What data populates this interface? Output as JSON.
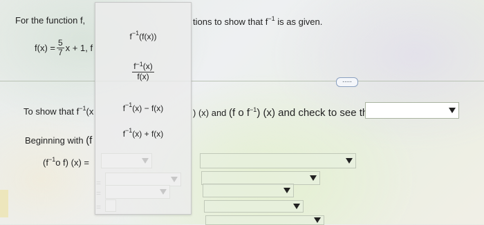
{
  "problem": {
    "intro": "For the function f,",
    "intro_right": "tions to show that f",
    "intro_right_sup": "−1",
    "intro_right_tail": "is as given.",
    "f_lhs": "f(x) =",
    "f_num": "5",
    "f_den": "7",
    "f_rhs": "x + 1, f",
    "show_left": "To show that f",
    "show_left_sup": "−1",
    "show_left_tail": "(x",
    "show_middle": ") (x) and",
    "composition_right": "(f o f",
    "composition_right_sup": "−1",
    "composition_right_tail": ") (x) and check to see that",
    "begin_text": "Beginning with",
    "begin_paren": "(f",
    "comp_lhs": "(f",
    "comp_lhs_sup": "−1",
    "comp_lhs_tail": "o f) (x) =",
    "eq_marks": [
      "=",
      "=",
      "="
    ],
    "more_button": "....."
  },
  "popup_options": [
    {
      "pre": "f",
      "sup": "−1",
      "post": "(f(x))"
    },
    {
      "pre": "f",
      "sup": "−1",
      "post": "(x)",
      "den": "f(x)"
    },
    {
      "pre": "f",
      "sup": "−1",
      "post": "(x) − f(x)"
    },
    {
      "pre": "f",
      "sup": "−1",
      "post": "(x) + f(x)"
    }
  ]
}
